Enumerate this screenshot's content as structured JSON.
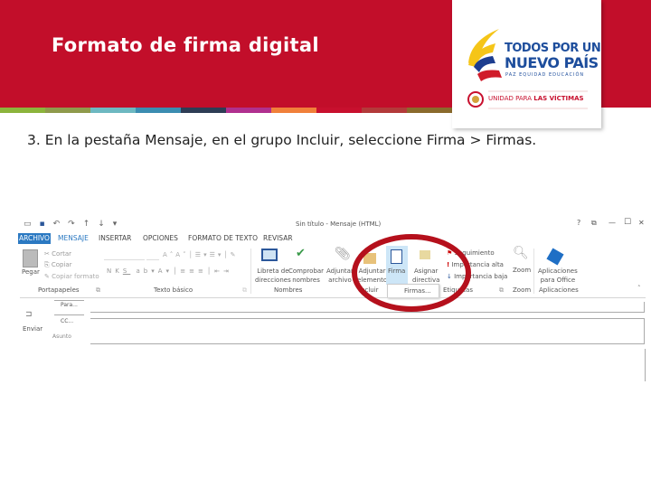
{
  "slide": {
    "title": "Formato de firma digital",
    "instruction": "3. En la pestaña Mensaje, en el grupo Incluir, seleccione Firma > Firmas.",
    "stripe_colors": [
      "#8cb43c",
      "#8f9a4c",
      "#6db8c1",
      "#3b8db1",
      "#2e3d55",
      "#b0308f",
      "#f0803a",
      "#c8102e",
      "#b33a3a",
      "#8a6a2c"
    ],
    "accent": "#c20e2a"
  },
  "logo": {
    "line1": "TODOS POR UN",
    "line2": "NUEVO PAÍS",
    "line3": "PAZ  EQUIDAD  EDUCACIÓN",
    "unit_prefix": "UNIDAD PARA ",
    "unit_bold": "LAS VÍCTIMAS"
  },
  "window": {
    "title": "Sin título - Mensaje (HTML)",
    "help": "?",
    "restore": "⧉",
    "minimize": "—",
    "maximize": "☐",
    "close": "✕"
  },
  "tabs": [
    {
      "label": "ARCHIVO"
    },
    {
      "label": "MENSAJE"
    },
    {
      "label": "INSERTAR"
    },
    {
      "label": "OPCIONES"
    },
    {
      "label": "FORMATO DE TEXTO"
    },
    {
      "label": "REVISAR"
    }
  ],
  "ribbon": {
    "clipboard": {
      "paste": "Pegar",
      "cut": "Cortar",
      "copy": "Copiar",
      "format_painter": "Copiar formato",
      "group": "Portapapeles"
    },
    "basic_text": {
      "bold": "N",
      "italic": "K",
      "underline": "S",
      "group": "Texto básico"
    },
    "names": {
      "address_book_1": "Libreta de",
      "address_book_2": "direcciones",
      "check_names_1": "Comprobar",
      "check_names_2": "nombres",
      "group": "Nombres"
    },
    "include": {
      "attach_file_1": "Adjuntar",
      "attach_file_2": "archivo",
      "attach_item_1": "Adjuntar",
      "attach_item_2": "elemento",
      "signature": "Firma",
      "signature_menu_item": "Firmas...",
      "group": "Incluir"
    },
    "tags": {
      "policy_1": "Asignar",
      "policy_2": "directiva",
      "follow_up": "Seguimiento",
      "high": "Importancia alta",
      "low": "Importancia baja",
      "group": "Etiquetas"
    },
    "zoom": {
      "label": "Zoom",
      "group": "Zoom"
    },
    "apps": {
      "label_1": "Aplicaciones",
      "label_2": "para Office",
      "group": "Aplicaciones"
    }
  },
  "compose": {
    "send": "Enviar",
    "to": "Para...",
    "cc": "CC...",
    "subject": "Asunto"
  }
}
